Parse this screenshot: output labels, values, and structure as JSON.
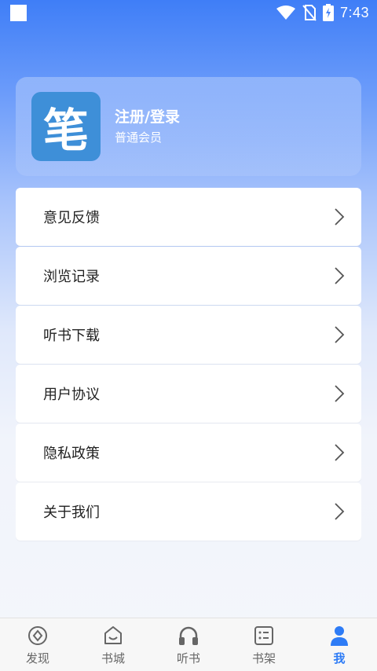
{
  "status_bar": {
    "time": "7:43"
  },
  "profile": {
    "logo_char": "笔",
    "title": "注册/登录",
    "level": "普通会员"
  },
  "menu": [
    {
      "label": "意见反馈"
    },
    {
      "label": "浏览记录"
    },
    {
      "label": "听书下载"
    },
    {
      "label": "用户协议"
    },
    {
      "label": "隐私政策"
    },
    {
      "label": "关于我们"
    }
  ],
  "bottom_nav": [
    {
      "label": "发现",
      "icon": "discover-icon"
    },
    {
      "label": "书城",
      "icon": "bookstore-icon"
    },
    {
      "label": "听书",
      "icon": "headphones-icon"
    },
    {
      "label": "书架",
      "icon": "bookshelf-icon"
    },
    {
      "label": "我",
      "icon": "profile-icon",
      "active": true
    }
  ],
  "colors": {
    "accent": "#2e7cf6",
    "logo_bg": "#3e8fd8"
  }
}
